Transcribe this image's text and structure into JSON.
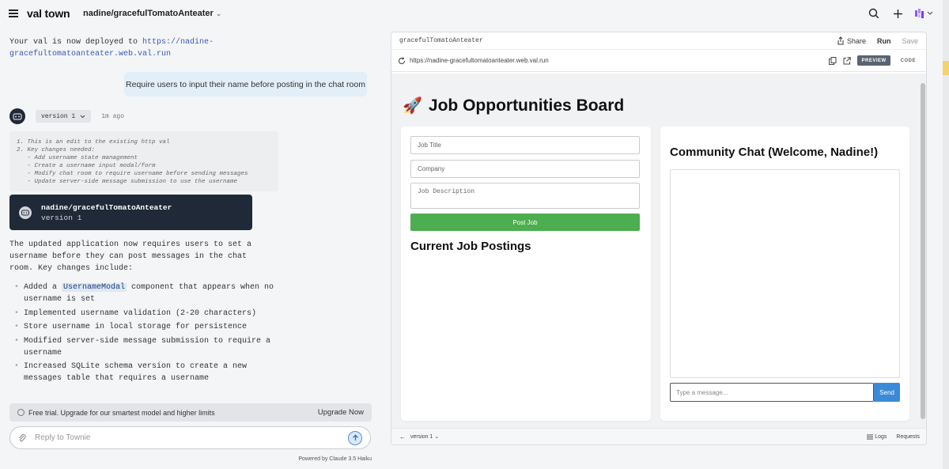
{
  "topbar": {
    "logo": "val town",
    "project": "nadine/gracefulTomatoAnteater",
    "project_chevron": "⌄",
    "icons": [
      "search-icon",
      "plus-icon",
      "user-avatar-icon"
    ]
  },
  "chat": {
    "deploy_text": "Your val is now deployed to ",
    "deploy_url": "https://nadine-gracefultomatoanteater.web.val.run",
    "user_message": "Require users to input their name before posting in the chat room",
    "version_label": "version 1",
    "time_ago": "1m ago",
    "thinking": "1. This is an edit to the existing http val\n2. Key changes needed:\n   - Add username state management\n   - Create a username input modal/form\n   - Modify chat room to require username before sending messages\n   - Update server-side message submission to use the username",
    "version_card": {
      "name": "nadine/gracefulTomatoAnteater",
      "version": "version 1"
    },
    "summary": "The updated application now requires users to set a username before they can post messages in the chat room. Key changes include:",
    "changes": [
      {
        "pre": "Added a ",
        "code": "UsernameModal",
        "post": " component that appears when no username is set"
      },
      {
        "pre": "Implemented username validation (2-20 characters)",
        "code": "",
        "post": ""
      },
      {
        "pre": "Store username in local storage for persistence",
        "code": "",
        "post": ""
      },
      {
        "pre": "Modified server-side message submission to require a username",
        "code": "",
        "post": ""
      },
      {
        "pre": "Increased SQLite schema version to create a new messages table that requires a username",
        "code": "",
        "post": ""
      }
    ],
    "trial_text": "Free trial. Upgrade for our smartest model and higher limits",
    "upgrade_label": "Upgrade Now",
    "reply_placeholder": "Reply to Townie",
    "powered_by": "Powered by Claude 3.5 Haiku"
  },
  "preview": {
    "val_name": "gracefulTomatoAnteater",
    "share_label": "Share",
    "run_label": "Run",
    "save_label": "Save",
    "url": "https://nadine-gracefultomatoanteater.web.val.run",
    "tab_preview": "PREVIEW",
    "tab_code": "CODE",
    "footer_version": "version 1",
    "logs_label": "Logs",
    "requests_label": "Requests"
  },
  "app": {
    "emoji": "🚀",
    "title": "Job Opportunities Board",
    "job_title_placeholder": "Job Title",
    "company_placeholder": "Company",
    "description_placeholder": "Job Description",
    "post_button": "Post Job",
    "postings_heading": "Current Job Postings",
    "chat_heading": "Community Chat (Welcome, Nadine!)",
    "message_placeholder": "Type a message...",
    "send_button": "Send"
  },
  "colors": {
    "accent_green": "#4cae4f",
    "accent_blue": "#3b8ad9",
    "dark_card": "#1f2937",
    "user_bubble": "#e2eef8"
  }
}
